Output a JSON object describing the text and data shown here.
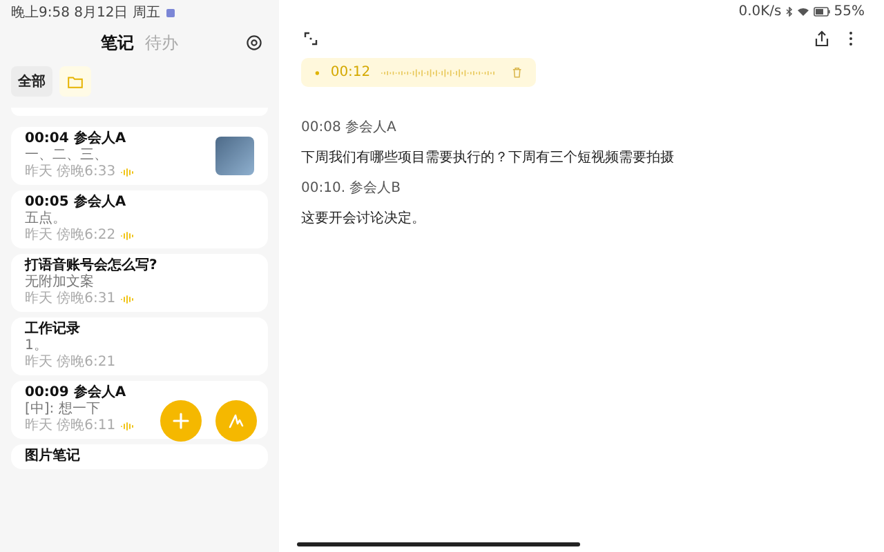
{
  "status_bar": {
    "time": "晚上9:58 8月12日 周五",
    "network_speed": "0.0K/s",
    "battery": "55%"
  },
  "sidebar": {
    "tabs": [
      {
        "label": "笔记",
        "selected": true
      },
      {
        "label": "待办",
        "selected": false
      }
    ],
    "filter": {
      "label": "全部"
    },
    "notes": [
      {
        "title": "00:04 参会人A",
        "body": "一、二、三、",
        "meta": "昨天 傍晚6:33",
        "has_audio": true,
        "thumbnail": true
      },
      {
        "title": "00:05 参会人A",
        "body": "五点。",
        "meta": "昨天 傍晚6:22",
        "has_audio": true,
        "thumbnail": false
      },
      {
        "title": "打语音账号会怎么写?",
        "body": "无附加文案",
        "meta": "昨天 傍晚6:31",
        "has_audio": true,
        "thumbnail": false
      },
      {
        "title": "工作记录",
        "body": "1。",
        "meta": "昨天 傍晚6:21",
        "has_audio": false,
        "thumbnail": false
      },
      {
        "title": "00:09 参会人A",
        "body": "[中]: 想一下",
        "meta": "昨天 傍晚6:11",
        "has_audio": true,
        "thumbnail": false
      },
      {
        "title": "图片笔记"
      }
    ]
  },
  "player": {
    "time": "00:12"
  },
  "transcript": [
    {
      "kind": "speaker",
      "text": "00:08 参会人A"
    },
    {
      "kind": "speech",
      "text": "下周我们有哪些项目需要执行的？下周有三个短视频需要拍摄"
    },
    {
      "kind": "speaker",
      "text": "00:10. 参会人B"
    },
    {
      "kind": "speech",
      "text": "这要开会讨论决定。"
    }
  ]
}
